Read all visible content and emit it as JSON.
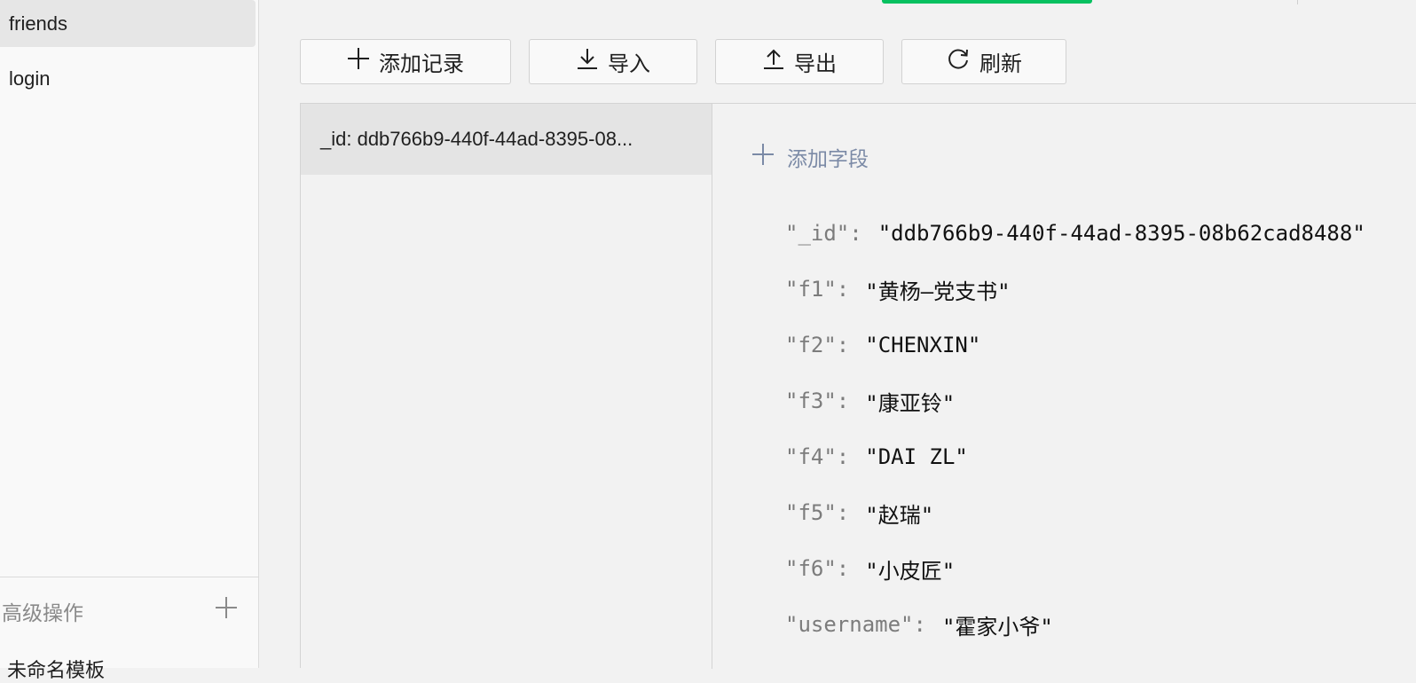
{
  "sidebar": {
    "collections": [
      {
        "label": "friends",
        "active": true
      },
      {
        "label": "login",
        "active": false
      }
    ],
    "advanced": {
      "title": "高级操作",
      "add_icon": "plus-icon",
      "template_label": "未命名模板"
    }
  },
  "toolbar": {
    "add_record": {
      "label": "添加记录",
      "icon": "plus-icon"
    },
    "import": {
      "label": "导入",
      "icon": "download-icon"
    },
    "export": {
      "label": "导出",
      "icon": "upload-icon"
    },
    "refresh": {
      "label": "刷新",
      "icon": "refresh-icon"
    }
  },
  "records": [
    {
      "label": "_id: ddb766b9-440f-44ad-8395-08..."
    }
  ],
  "document": {
    "add_field_label": "添加字段",
    "fields": [
      {
        "key": "\"_id\"",
        "value": "\"ddb766b9-440f-44ad-8395-08b62cad8488\""
      },
      {
        "key": "\"f1\"",
        "value": "\"黄杨—党支书\""
      },
      {
        "key": "\"f2\"",
        "value": "\"CHENXIN\""
      },
      {
        "key": "\"f3\"",
        "value": "\"康亚铃\""
      },
      {
        "key": "\"f4\"",
        "value": "\"DAI ZL\""
      },
      {
        "key": "\"f5\"",
        "value": "\"赵瑞\""
      },
      {
        "key": "\"f6\"",
        "value": "\"小皮匠\""
      },
      {
        "key": "\"username\"",
        "value": "\"霍家小爷\""
      }
    ]
  },
  "colors": {
    "accent": "#07c160",
    "add_field": "#7b8aa6",
    "key_gray": "#7c7c7c"
  }
}
